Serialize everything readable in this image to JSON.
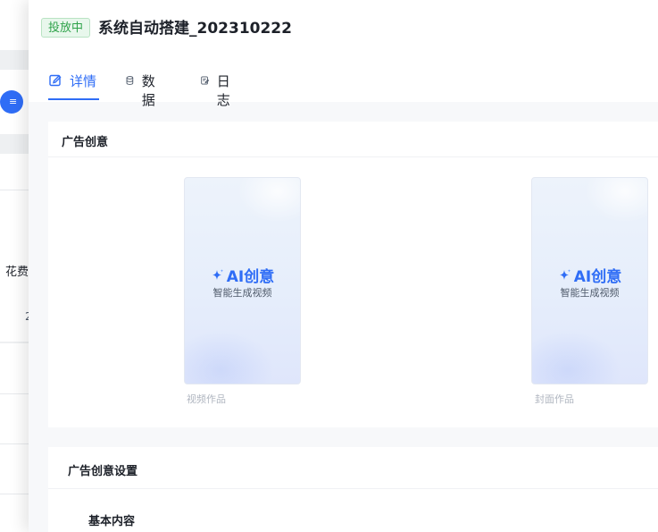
{
  "background": {
    "partial_label": "花费",
    "partial_number": "2"
  },
  "drawer": {
    "status_tag": "投放中",
    "title": "系统自动搭建_202310222",
    "tabs": [
      {
        "label": "详情",
        "icon": "edit-icon",
        "active": true
      },
      {
        "label": "数据",
        "icon": "database-icon",
        "active": false
      },
      {
        "label": "日志",
        "icon": "log-icon",
        "active": false
      }
    ]
  },
  "creative_section": {
    "title": "广告创意",
    "items": [
      {
        "ai_title": "AI创意",
        "ai_subtitle": "智能生成视频",
        "caption": "视频作品"
      },
      {
        "ai_title": "AI创意",
        "ai_subtitle": "智能生成视频",
        "caption": "封面作品"
      }
    ]
  },
  "settings_section": {
    "title": "广告创意设置",
    "subsection": "基本内容"
  },
  "colors": {
    "accent": "#2f6df6",
    "status_green": "#2fa34a",
    "status_green_bg": "#e8f7ec"
  }
}
